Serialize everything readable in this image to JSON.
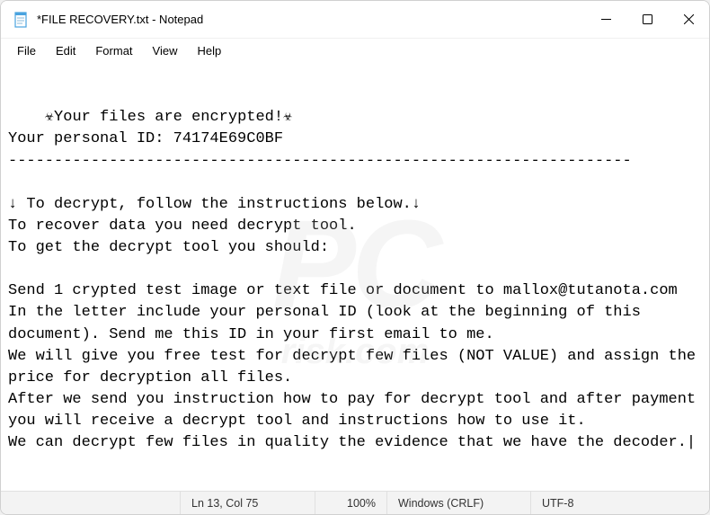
{
  "titlebar": {
    "title": "*FILE RECOVERY.txt - Notepad"
  },
  "menubar": {
    "file": "File",
    "edit": "Edit",
    "format": "Format",
    "view": "View",
    "help": "Help"
  },
  "content": {
    "text": "☣Your files are encrypted!☣\nYour personal ID: 74174E69C0BF\n--------------------------------------------------------------------\n\n↓ To decrypt, follow the instructions below.↓\nTo recover data you need decrypt tool.\nTo get the decrypt tool you should:\n\nSend 1 crypted test image or text file or document to mallox@tutanota.com\nIn the letter include your personal ID (look at the beginning of this document). Send me this ID in your first email to me.\nWe will give you free test for decrypt few files (NOT VALUE) and assign the price for decryption all files.\nAfter we send you instruction how to pay for decrypt tool and after payment you will receive a decrypt tool and instructions how to use it.\nWe can decrypt few files in quality the evidence that we have the decoder.|"
  },
  "statusbar": {
    "position": "Ln 13, Col 75",
    "zoom": "100%",
    "line_ending": "Windows (CRLF)",
    "encoding": "UTF-8"
  },
  "watermark": {
    "main": "PC",
    "sub": "risk.com"
  }
}
